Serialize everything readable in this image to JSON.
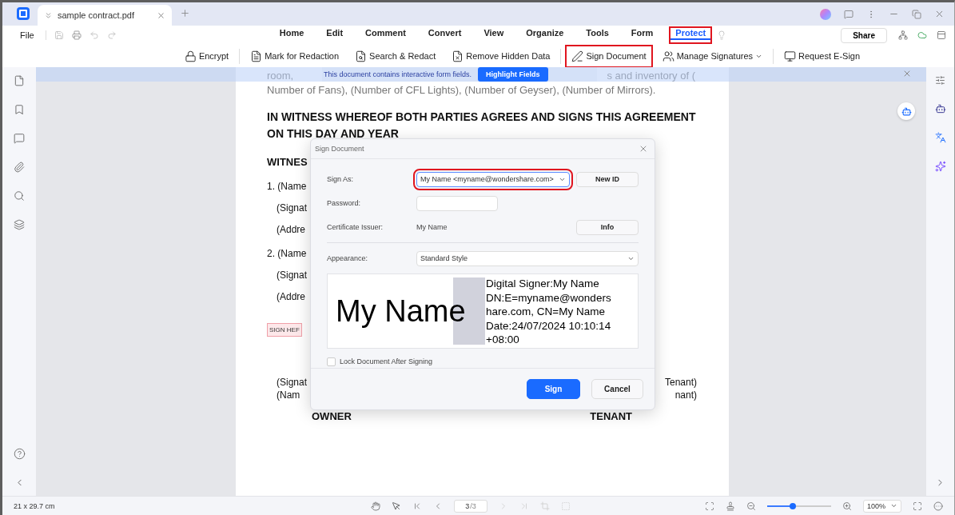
{
  "tab": {
    "title": "sample contract.pdf"
  },
  "menu": {
    "file": "File",
    "tabs": [
      {
        "label": "Home",
        "selected": false,
        "annotated": false
      },
      {
        "label": "Edit",
        "selected": false,
        "annotated": false
      },
      {
        "label": "Comment",
        "selected": false,
        "annotated": false
      },
      {
        "label": "Convert",
        "selected": false,
        "annotated": false
      },
      {
        "label": "View",
        "selected": false,
        "annotated": false
      },
      {
        "label": "Organize",
        "selected": false,
        "annotated": false
      },
      {
        "label": "Tools",
        "selected": false,
        "annotated": false
      },
      {
        "label": "Form",
        "selected": false,
        "annotated": false
      },
      {
        "label": "Protect",
        "selected": true,
        "annotated": true
      }
    ],
    "share": "Share"
  },
  "toolbar": {
    "groups": [
      [
        {
          "label": "Encrypt",
          "annotated": false,
          "caret": false
        }
      ],
      [
        {
          "label": "Mark for Redaction",
          "annotated": false,
          "caret": false
        },
        {
          "label": "Search & Redact",
          "annotated": false,
          "caret": false
        },
        {
          "label": "Remove Hidden Data",
          "annotated": false,
          "caret": false
        }
      ],
      [
        {
          "label": "Sign Document",
          "annotated": true,
          "caret": false
        },
        {
          "label": "Manage Signatures",
          "annotated": false,
          "caret": true
        }
      ],
      [
        {
          "label": "Request E-Sign",
          "annotated": false,
          "caret": false
        }
      ]
    ]
  },
  "banner": {
    "message": "This document contains interactive form fields.",
    "button": "Highlight Fields"
  },
  "document": {
    "intro_start": "room,",
    "intro_end": "s and inventory of (",
    "intro": "Number of Fans), (Number of CFL Lights), (Number of Geyser), (Number of Mirrors).",
    "heading": "IN WITNESS WHEREOF BOTH PARTIES AGREES AND SIGNS THIS AGREEMENT ON THIS DAY AND YEAR",
    "witness": "WITNES",
    "lines": [
      {
        "text": "1. (Name",
        "kind": "item"
      },
      {
        "text": "(Signat",
        "kind": "sub"
      },
      {
        "text": "(Addre",
        "kind": "sub"
      },
      {
        "text": "2. (Name",
        "kind": "item"
      },
      {
        "text": "(Signat",
        "kind": "sub"
      },
      {
        "text": "(Addre",
        "kind": "sub"
      }
    ],
    "sign_field": "SIGN HEF",
    "sign_rows": [
      {
        "left": "(Signat",
        "right": "Tenant)"
      },
      {
        "left": "(Nam",
        "right": "nant)"
      }
    ],
    "parties": [
      "OWNER",
      "TENANT"
    ]
  },
  "dialog": {
    "title": "Sign Document",
    "sign_as": {
      "label": "Sign As:",
      "value": "My Name <myname@wondershare.com>",
      "annotated": true,
      "button": "New ID"
    },
    "password": {
      "label": "Password:"
    },
    "issuer": {
      "label": "Certificate Issuer:",
      "value": "My Name",
      "button": "Info"
    },
    "appearance": {
      "label": "Appearance:",
      "value": "Standard Style"
    },
    "preview": {
      "name": "My Name",
      "details": [
        "Digital Signer:My Name",
        "DN:E=myname@wonders",
        "hare.com, CN=My Name",
        "Date:24/07/2024 10:10:14",
        "+08:00"
      ]
    },
    "lock": {
      "label": "Lock Document After Signing",
      "checked": false
    },
    "buttons": [
      {
        "label": "Sign",
        "kind": "primary"
      },
      {
        "label": "Cancel",
        "kind": "secondary"
      }
    ]
  },
  "status_bar": {
    "page_size": "21 x 29.7 cm",
    "page": {
      "current": "3",
      "total": "/3"
    },
    "zoom": {
      "level": 0.4,
      "value": "100%"
    }
  }
}
